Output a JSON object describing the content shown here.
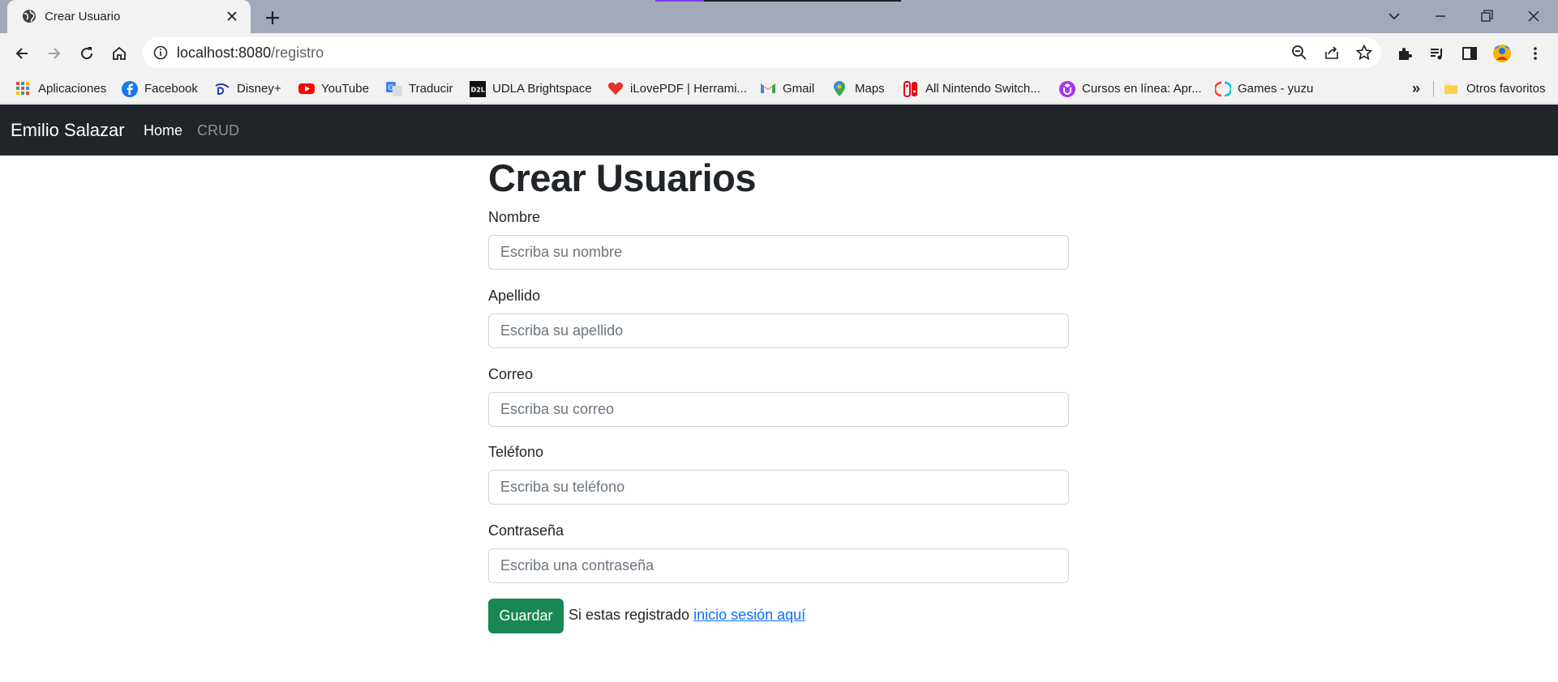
{
  "browser": {
    "tab": {
      "title": "Crear Usuario"
    },
    "address_bar": {
      "host": "localhost:8080",
      "path": "/registro"
    },
    "bookmarks": [
      {
        "label": "Aplicaciones",
        "icon": "apps-grid-icon"
      },
      {
        "label": "Facebook",
        "icon": "facebook-icon"
      },
      {
        "label": "Disney+",
        "icon": "disney-icon"
      },
      {
        "label": "YouTube",
        "icon": "youtube-icon"
      },
      {
        "label": "Traducir",
        "icon": "translate-icon"
      },
      {
        "label": "UDLA Brightspace",
        "icon": "d2l-icon"
      },
      {
        "label": "iLovePDF | Herrami...",
        "icon": "ilovepdf-icon"
      },
      {
        "label": "Gmail",
        "icon": "gmail-icon"
      },
      {
        "label": "Maps",
        "icon": "maps-icon"
      },
      {
        "label": "All Nintendo Switch...",
        "icon": "nintendo-switch-icon"
      },
      {
        "label": "Cursos en línea: Apr...",
        "icon": "udemy-icon"
      },
      {
        "label": "Games - yuzu",
        "icon": "yuzu-icon"
      }
    ],
    "overflow_label": "»",
    "other_bookmarks": "Otros favoritos"
  },
  "navbar": {
    "brand": "Emilio Salazar",
    "links": [
      "Home",
      "CRUD"
    ]
  },
  "form": {
    "title": "Crear Usuarios",
    "fields": [
      {
        "label": "Nombre",
        "placeholder": "Escriba su nombre",
        "value": ""
      },
      {
        "label": "Apellido",
        "placeholder": "Escriba su apellido",
        "value": ""
      },
      {
        "label": "Correo",
        "placeholder": "Escriba su correo",
        "value": ""
      },
      {
        "label": "Teléfono",
        "placeholder": "Escriba su teléfono",
        "value": ""
      },
      {
        "label": "Contraseña",
        "placeholder": "Escriba una contraseña",
        "value": ""
      }
    ],
    "submit_label": "Guardar",
    "login_prompt": "Si estas registrado",
    "login_link": "inicio sesión aquí"
  },
  "colors": {
    "navbar_bg": "#212529",
    "save_button": "#198754",
    "link": "#0d6efd",
    "tabstrip_bg": "#a4a9b9"
  }
}
